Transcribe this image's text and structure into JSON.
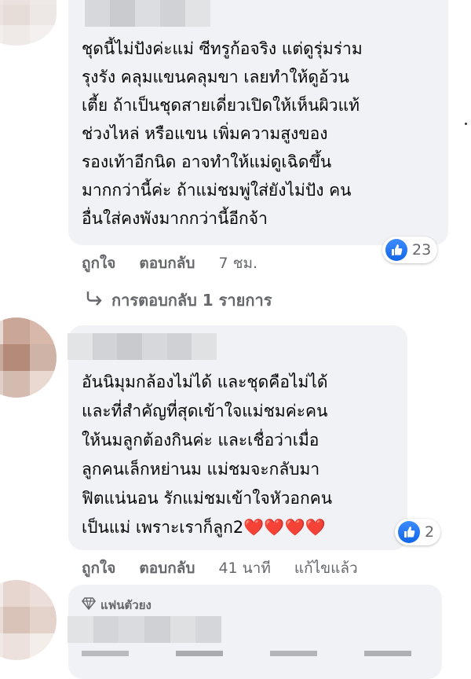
{
  "comments": [
    {
      "text_lines": [
        "ชุดนี้ไม่ปังค่ะแม่ ซีทรูก้อจริง แต่ดูรุ่มร่าม",
        "รุงรัง คลุมแขนคลุมขา เลยทำให้ดูอ้วน",
        "เตี้ย ถ้าเป็นชุดสายเดี่ยวเปิดให้เห็นผิวแท้",
        "ช่วงไหล่ หรือแขน เพิ่มความสูงของ",
        "รองเท้าอีกนิด อาจทำให้แม่ดูเฉิดขึ้น",
        "มากกว่านี้ค่ะ ถ้าแม่ชมพู่ใส่ยังไม่ปัง คน",
        "อื่นใส่คงพังมากกว่านี้อีกจ้า"
      ],
      "reaction_count": "23",
      "like_label": "ถูกใจ",
      "reply_label": "ตอบกลับ",
      "time": "7 ชม."
    },
    {
      "text_lines": [
        "อันนิมุมกล้องไม่ได้ และชุดคือไม่ได้",
        "และที่สำคัญที่สุดเข้าใจแม่ชมค่ะคน",
        "ให้นมลูกต้องกินค่ะ และเชื่อว่าเมื่อ",
        "ลูกคนเล็กหย่านม แม่ชมจะกลับมา",
        "ฟิตแน่นอน รักแม่ชมเข้าใจหัวอกคน",
        "เป็นแม่ เพราะเราก็ลูก2"
      ],
      "hearts": "❤️❤️❤️❤️",
      "reaction_count": "2",
      "like_label": "ถูกใจ",
      "reply_label": "ตอบกลับ",
      "time": "41 นาที",
      "edited_label": "แก้ไขแล้ว"
    }
  ],
  "replies_link": "การตอบกลับ 1 รายการ",
  "fan_badge": "แฟนตัวยง",
  "colors": {
    "bubble": "#f0f2f5",
    "meta_text": "#65676b",
    "like_blue": "#1877f2",
    "heart_red": "#e41e3f"
  },
  "icons": [
    "like-icon",
    "reply-arrow-icon",
    "diamond-icon",
    "heart-emoji"
  ]
}
